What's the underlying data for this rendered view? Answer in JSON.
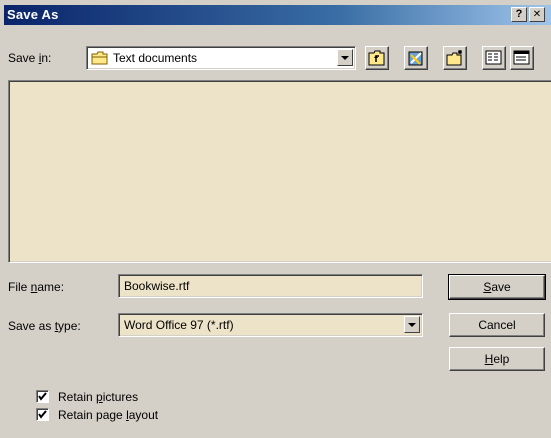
{
  "window": {
    "title": "Save As",
    "help_glyph": "?",
    "close_glyph": "✕"
  },
  "toolbar": {
    "save_in_prefix": "Save ",
    "save_in_accel": "i",
    "save_in_suffix": "n:",
    "location": "Text documents",
    "tools": [
      "up-one-level-icon",
      "search-web-icon",
      "create-new-folder-icon",
      "list-view-icon",
      "details-view-icon"
    ]
  },
  "file_name": {
    "prefix": "File ",
    "accel": "n",
    "suffix": "ame:",
    "value": "Bookwise.rtf"
  },
  "save_as_type": {
    "prefix": "Save as ",
    "accel": "t",
    "suffix": "ype:",
    "value": "Word Office 97 (*.rtf)"
  },
  "buttons": {
    "save": {
      "accel": "S",
      "rest": "ave"
    },
    "cancel": {
      "label": "Cancel"
    },
    "help": {
      "accel": "H",
      "rest": "elp"
    }
  },
  "options": {
    "retain_pictures": {
      "prefix": "Retain ",
      "accel": "p",
      "suffix": "ictures",
      "checked": true
    },
    "retain_layout": {
      "prefix": "Retain page ",
      "accel": "l",
      "suffix": "ayout",
      "checked": true
    }
  },
  "colors": {
    "field_bg": "#ede3c8",
    "titlebar": "#0a246a",
    "face": "#d4d0c8"
  }
}
